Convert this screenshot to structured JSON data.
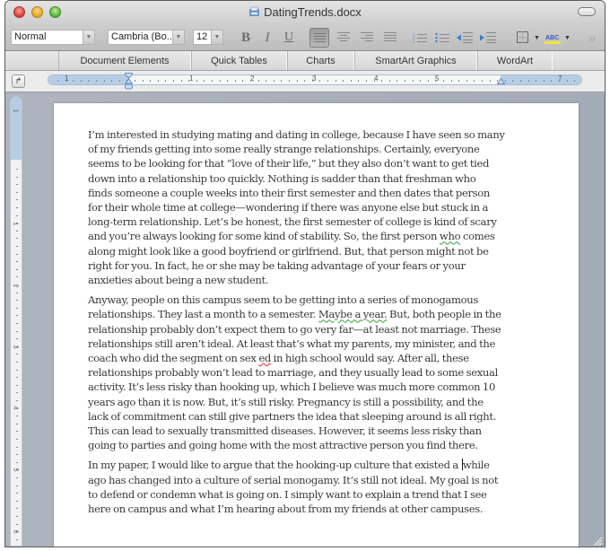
{
  "window": {
    "title": "DatingTrends.docx",
    "controls": [
      "close",
      "minimize",
      "zoom"
    ]
  },
  "toolbar": {
    "style_value": "Normal",
    "font_value": "Cambria (Bo...",
    "size_value": "12",
    "bold_label": "B",
    "italic_label": "I",
    "underline_label": "U",
    "alignment_active": "align-left",
    "highlight_color": "#f2e33a",
    "overflow_label": "»",
    "dropdown_glyph": "▼"
  },
  "gallery": {
    "tabs": [
      {
        "label": "Document Elements"
      },
      {
        "label": "Quick Tables"
      },
      {
        "label": "Charts"
      },
      {
        "label": "SmartArt Graphics"
      },
      {
        "label": "WordArt"
      }
    ]
  },
  "ruler": {
    "labels": [
      "1",
      "1",
      "2",
      "3",
      "4",
      "5",
      "7"
    ]
  },
  "vertical_ruler": {
    "labels": [
      "1",
      "1",
      "2",
      "3",
      "4",
      "5",
      "6"
    ]
  },
  "document": {
    "paragraphs": [
      {
        "lines": [
          "I’m interested in studying mating and dating in college, because I have seen so many",
          "of my friends getting into some really strange relationships. Certainly, everyone",
          "seems to be looking for that “love of their life,” but they also don’t want to get tied",
          "down into a relationship too quickly. Nothing is sadder than that freshman who",
          "finds someone a couple weeks into their first semester and then dates that person",
          "for their whole time at college—wondering if there was anyone else but stuck in a",
          "long-term relationship. Let’s be honest, the first semester of college is kind of scary",
          {
            "before": "and you’re always looking for some kind of stability. So, the first person ",
            "flag": "who",
            "after": " comes"
          },
          "along might look like a good boyfriend or girlfriend. But, that person might not be",
          "right for you. In fact, he or she may be taking advantage of your fears or your",
          "anxieties about being a new student."
        ]
      },
      {
        "lines": [
          "Anyway, people on this campus seem to be getting into a series of monogamous",
          {
            "before": "relationships. They last a month to a semester. ",
            "flag": "Maybe a year.",
            "after": " But, both people in the"
          },
          "relationship probably don’t expect them to go very far—at least not marriage. These",
          "relationships still aren’t ideal. At least that’s what my parents, my minister, and the",
          {
            "before": "coach who did the segment on sex ",
            "flag": "ed",
            "after": " in high school would say. After all, these"
          },
          "relationships probably won’t lead to marriage, and they usually lead to some sexual",
          "activity. It’s less risky than hooking up, which I believe was much more common 10",
          "years ago than it is now. But, it’s still risky. Pregnancy is still a possibility, and the",
          "lack of commitment can still give partners the idea that sleeping around is all right.",
          "This can lead to sexually transmitted diseases. However, it seems less risky than",
          "going to parties and going home with the most attractive person you find there."
        ]
      },
      {
        "lines": [
          {
            "before": "In my paper, I would like to argue that the hooking-up culture that existed a ",
            "caret": true,
            "after": "while"
          },
          "ago has changed into a culture of serial monogamy. It’s still not ideal. My goal is not",
          "to defend or condemn what is going on. I simply want to explain a trend that I see",
          "here on campus and what I’m hearing about from my friends at other campuses."
        ]
      }
    ],
    "grammar_flags": [
      "who",
      "Maybe a year."
    ],
    "spelling_flags": [
      "ed"
    ]
  },
  "colors": {
    "grammar_squiggle": "#3a9a3a",
    "spelling_squiggle": "#d32f2f",
    "ruler_margin": "#b7cde6"
  }
}
